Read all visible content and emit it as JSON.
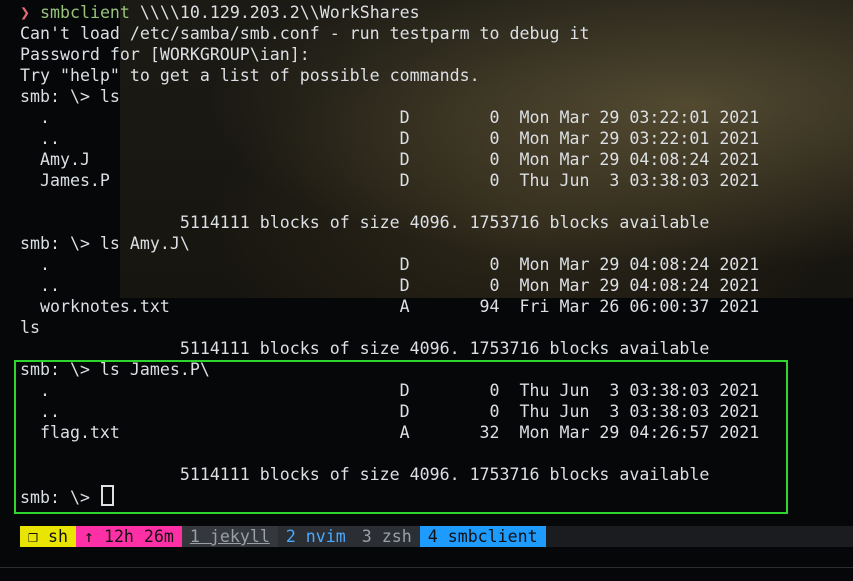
{
  "terminal": {
    "lines": [
      {
        "arrow": "❯",
        "cmd": "smbclient",
        "args": " \\\\\\\\10.129.203.2\\\\WorkShares"
      },
      {
        "text": "Can't load /etc/samba/smb.conf - run testparm to debug it"
      },
      {
        "text": "Password for [WORKGROUP\\ian]:"
      },
      {
        "text": "Try \"help\" to get a list of possible commands."
      },
      {
        "text": "smb: \\> ls"
      },
      {
        "text": "  .                                   D        0  Mon Mar 29 03:22:01 2021"
      },
      {
        "text": "  ..                                  D        0  Mon Mar 29 03:22:01 2021"
      },
      {
        "text": "  Amy.J                               D        0  Mon Mar 29 04:08:24 2021"
      },
      {
        "text": "  James.P                             D        0  Thu Jun  3 03:38:03 2021"
      },
      {
        "text": ""
      },
      {
        "text": "                5114111 blocks of size 4096. 1753716 blocks available"
      },
      {
        "text": "smb: \\> ls Amy.J\\"
      },
      {
        "text": "  .                                   D        0  Mon Mar 29 04:08:24 2021"
      },
      {
        "text": "  ..                                  D        0  Mon Mar 29 04:08:24 2021"
      },
      {
        "text": "  worknotes.txt                       A       94  Fri Mar 26 06:00:37 2021"
      },
      {
        "text": "ls"
      },
      {
        "text": "                5114111 blocks of size 4096. 1753716 blocks available"
      },
      {
        "text": "smb: \\> ls James.P\\"
      },
      {
        "text": "  .                                   D        0  Thu Jun  3 03:38:03 2021"
      },
      {
        "text": "  ..                                  D        0  Thu Jun  3 03:38:03 2021"
      },
      {
        "text": "  flag.txt                            A       32  Mon Mar 29 04:26:57 2021"
      },
      {
        "text": ""
      },
      {
        "text": "                5114111 blocks of size 4096. 1753716 blocks available"
      },
      {
        "text": "smb: \\> "
      }
    ]
  },
  "statusbar": {
    "session": "❐ sh",
    "uptime": "↑ 12h 26m",
    "windows": [
      "1 jekyll",
      "2 nvim",
      "3 zsh",
      "4 smbclient"
    ]
  },
  "colors": {
    "highlight_box": "#2fd52f",
    "prompt_arrow": "#e06c75",
    "command": "#98c379",
    "session_bg": "#e9e400",
    "uptime_bg": "#ff2fa5",
    "active_window_bg": "#1e9bff"
  }
}
